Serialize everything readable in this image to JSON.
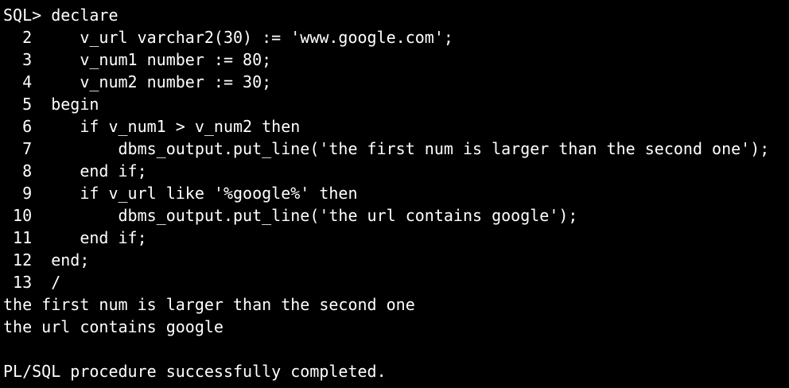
{
  "terminal": {
    "background": "#000000",
    "foreground": "#ffffff",
    "lines": [
      "SQL> declare",
      "  2     v_url varchar2(30) := 'www.google.com';",
      "  3     v_num1 number := 80;",
      "  4     v_num2 number := 30;",
      "  5  begin",
      "  6     if v_num1 > v_num2 then",
      "  7         dbms_output.put_line('the first num is larger than the second one');",
      "  8     end if;",
      "  9     if v_url like '%google%' then",
      " 10         dbms_output.put_line('the url contains google');",
      " 11     end if;",
      " 12  end;",
      " 13  /",
      "the first num is larger than the second one",
      "the url contains google",
      "",
      "PL/SQL procedure successfully completed."
    ]
  }
}
